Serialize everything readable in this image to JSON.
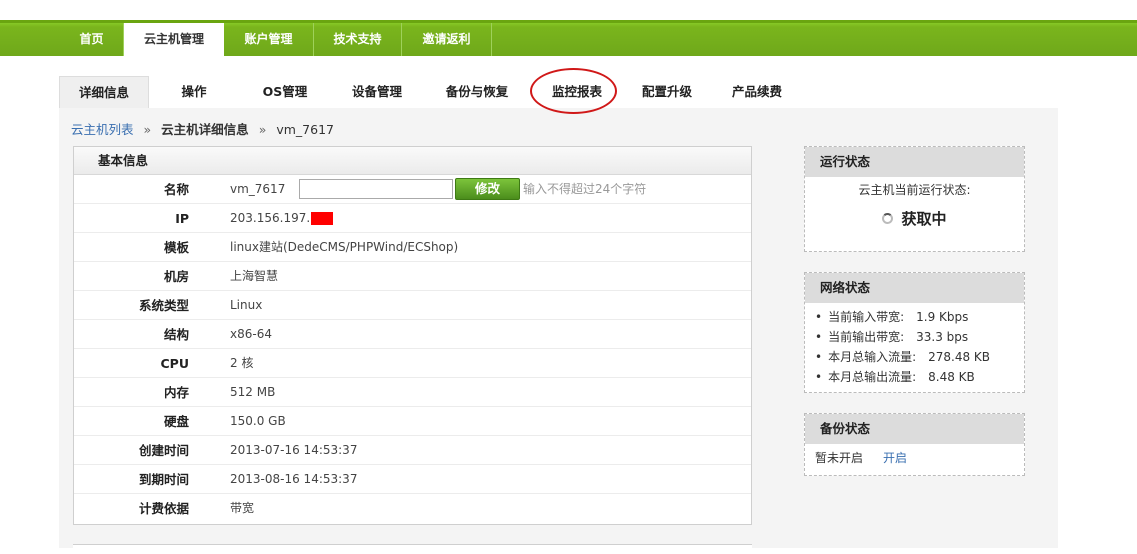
{
  "nav": {
    "items": [
      {
        "label": "首页"
      },
      {
        "label": "云主机管理"
      },
      {
        "label": "账户管理"
      },
      {
        "label": "技术支持"
      },
      {
        "label": "邀请返利"
      }
    ],
    "active_index": 1
  },
  "tabs": {
    "items": [
      {
        "label": "详细信息"
      },
      {
        "label": "操作"
      },
      {
        "label": "OS管理"
      },
      {
        "label": "设备管理"
      },
      {
        "label": "备份与恢复"
      },
      {
        "label": "监控报表"
      },
      {
        "label": "配置升级"
      },
      {
        "label": "产品续费"
      }
    ],
    "active_index": 0,
    "highlighted_index": 5
  },
  "breadcrumb": {
    "list_link": "云主机列表",
    "sep": "»",
    "detail": "云主机详细信息",
    "vm": "vm_7617"
  },
  "basic_info": {
    "title": "基本信息",
    "name_label": "名称",
    "name_value": "vm_7617",
    "name_input_value": "",
    "edit_button": "修改",
    "hint": "输入不得超过24个字符",
    "rows": [
      {
        "label": "IP",
        "value": "203.156.197."
      },
      {
        "label": "模板",
        "value": "linux建站(DedeCMS/PHPWind/ECShop)"
      },
      {
        "label": "机房",
        "value": "上海智慧"
      },
      {
        "label": "系统类型",
        "value": "Linux"
      },
      {
        "label": "结构",
        "value": "x86-64"
      },
      {
        "label": "CPU",
        "value": "2 核"
      },
      {
        "label": "内存",
        "value": "512 MB"
      },
      {
        "label": "硬盘",
        "value": "150.0 GB"
      },
      {
        "label": "创建时间",
        "value": "2013-07-16 14:53:37"
      },
      {
        "label": "到期时间",
        "value": "2013-08-16 14:53:37"
      },
      {
        "label": "计费依据",
        "value": "带宽"
      }
    ]
  },
  "run_status": {
    "title": "运行状态",
    "line": "云主机当前运行状态:",
    "state": "获取中"
  },
  "net_status": {
    "title": "网络状态",
    "items": [
      {
        "label": "当前输入带宽:",
        "value": "1.9 Kbps"
      },
      {
        "label": "当前输出带宽:",
        "value": "33.3 bps"
      },
      {
        "label": "本月总输入流量:",
        "value": "278.48 KB"
      },
      {
        "label": "本月总输出流量:",
        "value": "8.48 KB"
      }
    ]
  },
  "backup_status": {
    "title": "备份状态",
    "state": "暂未开启",
    "action": "开启"
  },
  "colors": {
    "nav_green": "#7ab51d",
    "link_blue": "#3a6fb0",
    "highlight_red": "#d01818",
    "redaction": "#ff0000"
  }
}
